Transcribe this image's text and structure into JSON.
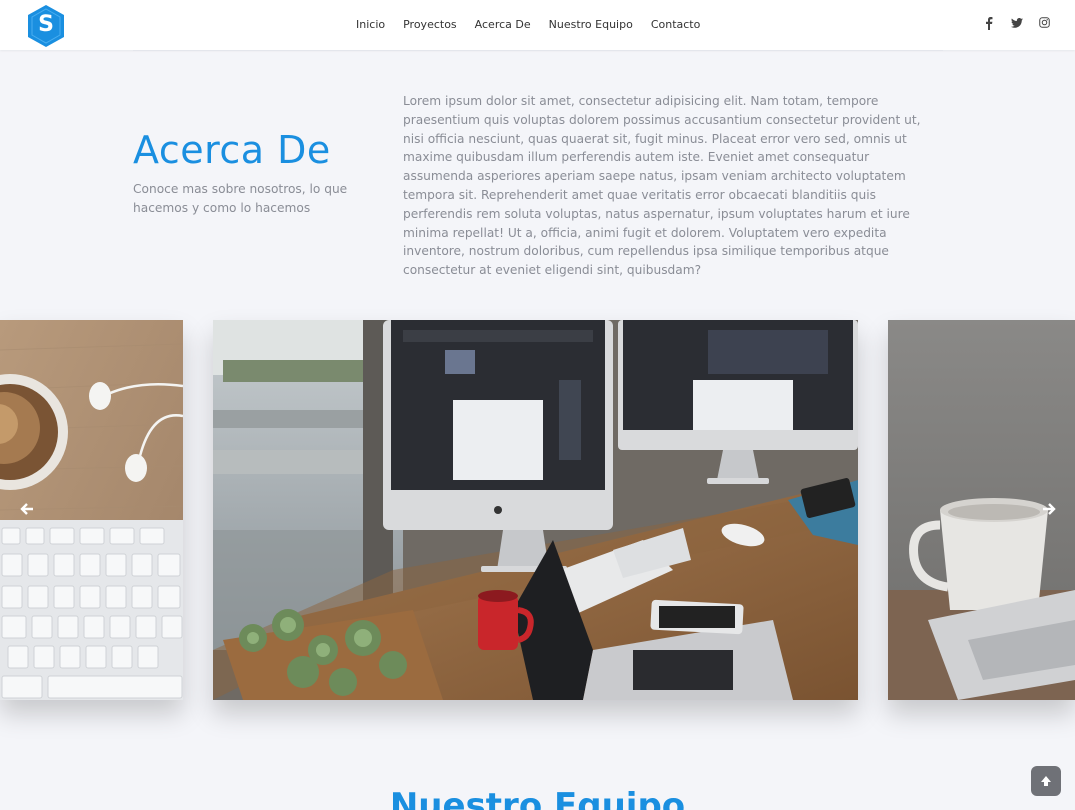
{
  "brand": {
    "logo_letter": "S",
    "color": "#1a8fe0"
  },
  "nav": {
    "items": [
      "Inicio",
      "Proyectos",
      "Acerca De",
      "Nuestro Equipo",
      "Contacto"
    ]
  },
  "social": {
    "icons": [
      "facebook-icon",
      "twitter-icon",
      "instagram-icon"
    ],
    "glyphs": [
      "f",
      "t",
      "◎"
    ]
  },
  "about": {
    "title": "Acerca De",
    "subtitle": "Conoce mas sobre nosotros, lo que hacemos y como lo hacemos",
    "body": "Lorem ipsum dolor sit amet, consectetur adipisicing elit. Nam totam, tempore praesentium quis voluptas dolorem possimus accusantium consectetur provident ut, nisi officia nesciunt, quas quaerat sit, fugit minus. Placeat error vero sed, omnis ut maxime quibusdam illum perferendis autem iste. Eveniet amet consequatur assumenda asperiores aperiam saepe natus, ipsam veniam architecto voluptatem tempora sit. Reprehenderit amet quae veritatis error obcaecati blanditiis quis perferendis rem soluta voluptas, natus aspernatur, ipsum voluptates harum et iure minima repellat! Ut a, officia, animi fugit et dolorem. Voluptatem vero expedita inventore, nostrum doloribus, cum repellendus ipsa similique temporibus atque consectetur at eveniet eligendi sint, quibusdam?"
  },
  "carousel": {
    "prev_glyph": "➜",
    "next_glyph": "➜"
  },
  "team": {
    "title": "Nuestro Equipo"
  },
  "scroll_top": {
    "glyph": "▲"
  },
  "colors": {
    "accent": "#1a8fe0",
    "background": "#f4f5f9",
    "text_muted": "#8a8d96"
  }
}
